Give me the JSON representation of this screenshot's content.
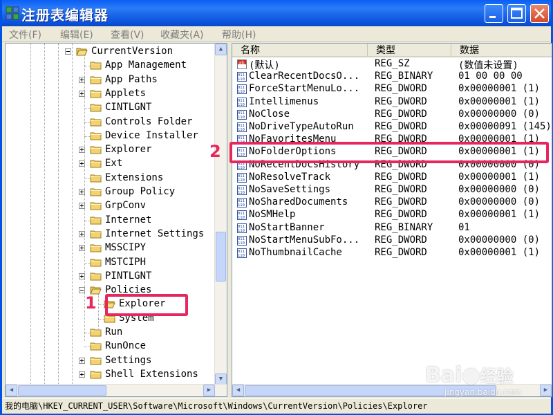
{
  "window": {
    "title": "注册表编辑器"
  },
  "menu": [
    "文件(F)",
    "编辑(E)",
    "查看(V)",
    "收藏夹(A)",
    "帮助(H)"
  ],
  "tree": {
    "items": [
      {
        "label": "CurrentVersion",
        "level": 0,
        "expander": "minus",
        "open": true
      },
      {
        "label": "App Management",
        "level": 1,
        "expander": "none"
      },
      {
        "label": "App Paths",
        "level": 1,
        "expander": "plus"
      },
      {
        "label": "Applets",
        "level": 1,
        "expander": "plus"
      },
      {
        "label": "CINTLGNT",
        "level": 1,
        "expander": "none"
      },
      {
        "label": "Controls Folder",
        "level": 1,
        "expander": "none"
      },
      {
        "label": "Device Installer",
        "level": 1,
        "expander": "none"
      },
      {
        "label": "Explorer",
        "level": 1,
        "expander": "plus"
      },
      {
        "label": "Ext",
        "level": 1,
        "expander": "plus"
      },
      {
        "label": "Extensions",
        "level": 1,
        "expander": "none"
      },
      {
        "label": "Group Policy",
        "level": 1,
        "expander": "plus"
      },
      {
        "label": "GrpConv",
        "level": 1,
        "expander": "plus"
      },
      {
        "label": "Internet",
        "level": 1,
        "expander": "none"
      },
      {
        "label": "Internet Settings",
        "level": 1,
        "expander": "plus"
      },
      {
        "label": "MSSCIPY",
        "level": 1,
        "expander": "plus"
      },
      {
        "label": "MSTCIPH",
        "level": 1,
        "expander": "none"
      },
      {
        "label": "PINTLGNT",
        "level": 1,
        "expander": "plus"
      },
      {
        "label": "Policies",
        "level": 1,
        "expander": "minus",
        "open": true
      },
      {
        "label": "Explorer",
        "level": 2,
        "expander": "none",
        "open": true,
        "selected": true
      },
      {
        "label": "System",
        "level": 2,
        "expander": "none"
      },
      {
        "label": "Run",
        "level": 1,
        "expander": "none"
      },
      {
        "label": "RunOnce",
        "level": 1,
        "expander": "none"
      },
      {
        "label": "Settings",
        "level": 1,
        "expander": "plus"
      },
      {
        "label": "Shell Extensions",
        "level": 1,
        "expander": "plus"
      }
    ]
  },
  "list": {
    "columns": [
      "名称",
      "类型",
      "数据"
    ],
    "rows": [
      {
        "icon": "string-value-icon",
        "name": "(默认)",
        "type": "REG_SZ",
        "data": "(数值未设置)"
      },
      {
        "icon": "binary-value-icon",
        "name": "ClearRecentDocsO...",
        "type": "REG_BINARY",
        "data": "01 00 00 00"
      },
      {
        "icon": "binary-value-icon",
        "name": "ForceStartMenuLo...",
        "type": "REG_DWORD",
        "data": "0x00000001 (1)"
      },
      {
        "icon": "binary-value-icon",
        "name": "Intellimenus",
        "type": "REG_DWORD",
        "data": "0x00000001 (1)"
      },
      {
        "icon": "binary-value-icon",
        "name": "NoClose",
        "type": "REG_DWORD",
        "data": "0x00000000 (0)"
      },
      {
        "icon": "binary-value-icon",
        "name": "NoDriveTypeAutoRun",
        "type": "REG_DWORD",
        "data": "0x00000091 (145)"
      },
      {
        "icon": "binary-value-icon",
        "name": "NoFavoritesMenu",
        "type": "REG_DWORD",
        "data": "0x00000001 (1)"
      },
      {
        "icon": "binary-value-icon",
        "name": "NoFolderOptions",
        "type": "REG_DWORD",
        "data": "0x00000001 (1)"
      },
      {
        "icon": "binary-value-icon",
        "name": "NoRecentDocsHistory",
        "type": "REG_DWORD",
        "data": "0x00000000 (0)"
      },
      {
        "icon": "binary-value-icon",
        "name": "NoResolveTrack",
        "type": "REG_DWORD",
        "data": "0x00000001 (1)"
      },
      {
        "icon": "binary-value-icon",
        "name": "NoSaveSettings",
        "type": "REG_DWORD",
        "data": "0x00000000 (0)"
      },
      {
        "icon": "binary-value-icon",
        "name": "NoSharedDocuments",
        "type": "REG_DWORD",
        "data": "0x00000000 (0)"
      },
      {
        "icon": "binary-value-icon",
        "name": "NoSMHelp",
        "type": "REG_DWORD",
        "data": "0x00000001 (1)"
      },
      {
        "icon": "binary-value-icon",
        "name": "NoStartBanner",
        "type": "REG_BINARY",
        "data": "01"
      },
      {
        "icon": "binary-value-icon",
        "name": "NoStartMenuSubFo...",
        "type": "REG_DWORD",
        "data": "0x00000000 (0)"
      },
      {
        "icon": "binary-value-icon",
        "name": "NoThumbnailCache",
        "type": "REG_DWORD",
        "data": "0x00000001 (1)"
      }
    ]
  },
  "statusbar": {
    "path": "我的电脑\\HKEY_CURRENT_USER\\Software\\Microsoft\\Windows\\CurrentVersion\\Policies\\Explorer"
  },
  "annotations": {
    "marker1": "1",
    "marker2": "2",
    "color": "#e6265e"
  },
  "watermark": {
    "brand": "Bai",
    "brand_cn": "经验",
    "url": "jingyan.baidu.com"
  },
  "colors": {
    "titlebar": "#0a52dc",
    "window": "#ece9d8",
    "highlight": "#e6265e"
  }
}
